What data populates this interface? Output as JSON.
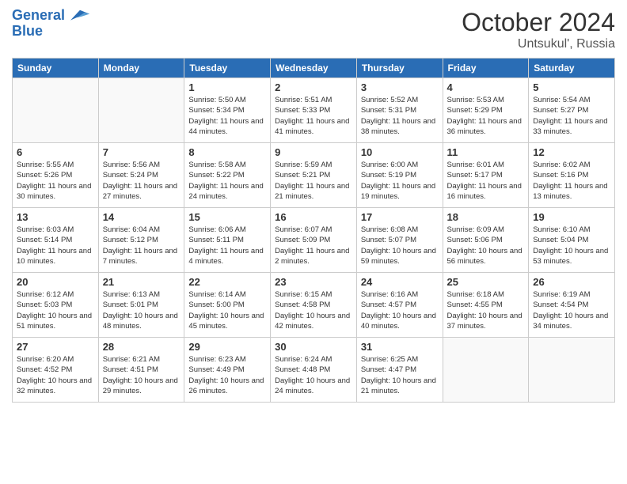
{
  "header": {
    "logo_line1": "General",
    "logo_line2": "Blue",
    "month": "October 2024",
    "location": "Untsukul', Russia"
  },
  "days_of_week": [
    "Sunday",
    "Monday",
    "Tuesday",
    "Wednesday",
    "Thursday",
    "Friday",
    "Saturday"
  ],
  "weeks": [
    [
      {
        "day": "",
        "info": ""
      },
      {
        "day": "",
        "info": ""
      },
      {
        "day": "1",
        "info": "Sunrise: 5:50 AM\nSunset: 5:34 PM\nDaylight: 11 hours and 44 minutes."
      },
      {
        "day": "2",
        "info": "Sunrise: 5:51 AM\nSunset: 5:33 PM\nDaylight: 11 hours and 41 minutes."
      },
      {
        "day": "3",
        "info": "Sunrise: 5:52 AM\nSunset: 5:31 PM\nDaylight: 11 hours and 38 minutes."
      },
      {
        "day": "4",
        "info": "Sunrise: 5:53 AM\nSunset: 5:29 PM\nDaylight: 11 hours and 36 minutes."
      },
      {
        "day": "5",
        "info": "Sunrise: 5:54 AM\nSunset: 5:27 PM\nDaylight: 11 hours and 33 minutes."
      }
    ],
    [
      {
        "day": "6",
        "info": "Sunrise: 5:55 AM\nSunset: 5:26 PM\nDaylight: 11 hours and 30 minutes."
      },
      {
        "day": "7",
        "info": "Sunrise: 5:56 AM\nSunset: 5:24 PM\nDaylight: 11 hours and 27 minutes."
      },
      {
        "day": "8",
        "info": "Sunrise: 5:58 AM\nSunset: 5:22 PM\nDaylight: 11 hours and 24 minutes."
      },
      {
        "day": "9",
        "info": "Sunrise: 5:59 AM\nSunset: 5:21 PM\nDaylight: 11 hours and 21 minutes."
      },
      {
        "day": "10",
        "info": "Sunrise: 6:00 AM\nSunset: 5:19 PM\nDaylight: 11 hours and 19 minutes."
      },
      {
        "day": "11",
        "info": "Sunrise: 6:01 AM\nSunset: 5:17 PM\nDaylight: 11 hours and 16 minutes."
      },
      {
        "day": "12",
        "info": "Sunrise: 6:02 AM\nSunset: 5:16 PM\nDaylight: 11 hours and 13 minutes."
      }
    ],
    [
      {
        "day": "13",
        "info": "Sunrise: 6:03 AM\nSunset: 5:14 PM\nDaylight: 11 hours and 10 minutes."
      },
      {
        "day": "14",
        "info": "Sunrise: 6:04 AM\nSunset: 5:12 PM\nDaylight: 11 hours and 7 minutes."
      },
      {
        "day": "15",
        "info": "Sunrise: 6:06 AM\nSunset: 5:11 PM\nDaylight: 11 hours and 4 minutes."
      },
      {
        "day": "16",
        "info": "Sunrise: 6:07 AM\nSunset: 5:09 PM\nDaylight: 11 hours and 2 minutes."
      },
      {
        "day": "17",
        "info": "Sunrise: 6:08 AM\nSunset: 5:07 PM\nDaylight: 10 hours and 59 minutes."
      },
      {
        "day": "18",
        "info": "Sunrise: 6:09 AM\nSunset: 5:06 PM\nDaylight: 10 hours and 56 minutes."
      },
      {
        "day": "19",
        "info": "Sunrise: 6:10 AM\nSunset: 5:04 PM\nDaylight: 10 hours and 53 minutes."
      }
    ],
    [
      {
        "day": "20",
        "info": "Sunrise: 6:12 AM\nSunset: 5:03 PM\nDaylight: 10 hours and 51 minutes."
      },
      {
        "day": "21",
        "info": "Sunrise: 6:13 AM\nSunset: 5:01 PM\nDaylight: 10 hours and 48 minutes."
      },
      {
        "day": "22",
        "info": "Sunrise: 6:14 AM\nSunset: 5:00 PM\nDaylight: 10 hours and 45 minutes."
      },
      {
        "day": "23",
        "info": "Sunrise: 6:15 AM\nSunset: 4:58 PM\nDaylight: 10 hours and 42 minutes."
      },
      {
        "day": "24",
        "info": "Sunrise: 6:16 AM\nSunset: 4:57 PM\nDaylight: 10 hours and 40 minutes."
      },
      {
        "day": "25",
        "info": "Sunrise: 6:18 AM\nSunset: 4:55 PM\nDaylight: 10 hours and 37 minutes."
      },
      {
        "day": "26",
        "info": "Sunrise: 6:19 AM\nSunset: 4:54 PM\nDaylight: 10 hours and 34 minutes."
      }
    ],
    [
      {
        "day": "27",
        "info": "Sunrise: 6:20 AM\nSunset: 4:52 PM\nDaylight: 10 hours and 32 minutes."
      },
      {
        "day": "28",
        "info": "Sunrise: 6:21 AM\nSunset: 4:51 PM\nDaylight: 10 hours and 29 minutes."
      },
      {
        "day": "29",
        "info": "Sunrise: 6:23 AM\nSunset: 4:49 PM\nDaylight: 10 hours and 26 minutes."
      },
      {
        "day": "30",
        "info": "Sunrise: 6:24 AM\nSunset: 4:48 PM\nDaylight: 10 hours and 24 minutes."
      },
      {
        "day": "31",
        "info": "Sunrise: 6:25 AM\nSunset: 4:47 PM\nDaylight: 10 hours and 21 minutes."
      },
      {
        "day": "",
        "info": ""
      },
      {
        "day": "",
        "info": ""
      }
    ]
  ]
}
